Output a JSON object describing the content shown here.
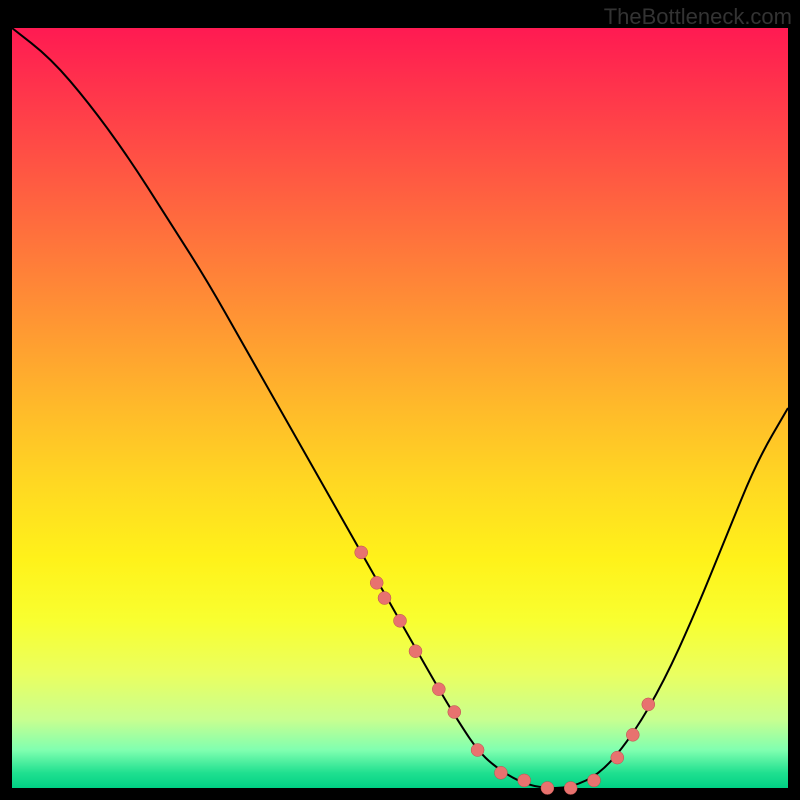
{
  "watermark": "TheBottleneck.com",
  "colors": {
    "background": "#000000",
    "curve": "#000000",
    "marker_fill": "#e8726f",
    "marker_stroke": "#b8504d"
  },
  "chart_data": {
    "type": "line",
    "title": "",
    "xlabel": "",
    "ylabel": "",
    "xlim": [
      0,
      100
    ],
    "ylim": [
      0,
      100
    ],
    "series": [
      {
        "name": "bottleneck-curve",
        "x": [
          0,
          5,
          10,
          15,
          20,
          25,
          30,
          35,
          40,
          45,
          50,
          55,
          58,
          60,
          62,
          65,
          68,
          72,
          76,
          80,
          84,
          88,
          92,
          96,
          100
        ],
        "y": [
          100,
          96,
          90,
          83,
          75,
          67,
          58,
          49,
          40,
          31,
          22,
          13,
          8,
          5,
          3,
          1,
          0,
          0,
          2,
          7,
          14,
          23,
          33,
          43,
          50
        ]
      }
    ],
    "markers": {
      "name": "sample-points",
      "x": [
        45,
        47,
        48,
        50,
        52,
        55,
        57,
        60,
        63,
        66,
        69,
        72,
        75,
        78,
        80,
        82
      ],
      "y": [
        31,
        27,
        25,
        22,
        18,
        13,
        10,
        5,
        2,
        1,
        0,
        0,
        1,
        4,
        7,
        11
      ]
    },
    "gradient_stops": [
      {
        "pos": 0,
        "color": "#ff1a52"
      },
      {
        "pos": 50,
        "color": "#ffba2a"
      },
      {
        "pos": 78,
        "color": "#f8ff30"
      },
      {
        "pos": 100,
        "color": "#00d084"
      }
    ]
  }
}
